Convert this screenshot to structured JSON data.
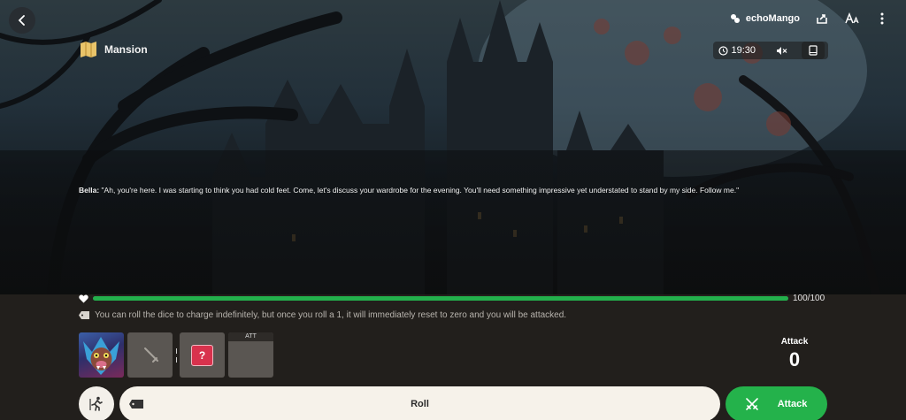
{
  "scene": {
    "location_label": "Mansion",
    "map_icon": "map-icon",
    "dialog_speaker": "Bella:",
    "dialog_text": "\"Ah, you're here. I was starting to think you had cold feet. Come, let's discuss your wardrobe for the evening. You'll need something impressive yet understated to stand by my side. Follow me.\""
  },
  "header": {
    "brand_name": "echoMango",
    "time": "19:30"
  },
  "status": {
    "hp_text": "100/100",
    "hp_fraction": 1.0,
    "hint": "You can roll the dice to charge indefinitely, but once you roll a 1, it will immediately reset to zero and you will be attacked."
  },
  "cards": {
    "att_tag": "ATT",
    "unknown_symbol": "?"
  },
  "attack_stat": {
    "label": "Attack",
    "value": "0"
  },
  "actions": {
    "roll_label": "Roll",
    "attack_label": "Attack"
  },
  "colors": {
    "hp_green": "#23b04c",
    "attack_green": "#24b24b",
    "question_red": "#d8324d"
  }
}
